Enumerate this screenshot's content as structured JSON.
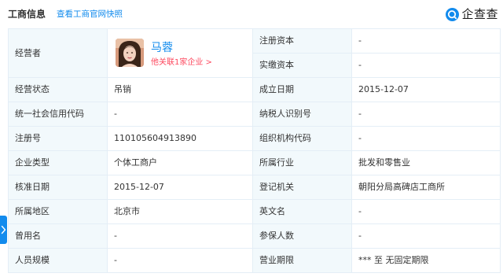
{
  "header": {
    "section_title": "工商信息",
    "snapshot_link": "查看工商官网快照",
    "brand_name": "企查查",
    "brand_icon": "qcc-logo-icon"
  },
  "operator": {
    "label": "经营者",
    "name": "马蓉",
    "associated_link": "他关联1家企业 >",
    "avatar": "operator-avatar"
  },
  "capital": {
    "registered_label": "注册资本",
    "registered_value": "-",
    "paid_label": "实缴资本",
    "paid_value": "-"
  },
  "rows": [
    {
      "k1": "经营状态",
      "v1": "吊销",
      "k2": "成立日期",
      "v2": "2015-12-07"
    },
    {
      "k1": "统一社会信用代码",
      "v1": "-",
      "k2": "纳税人识别号",
      "v2": "-"
    },
    {
      "k1": "注册号",
      "v1": "110105604913890",
      "k2": "组织机构代码",
      "v2": "-"
    },
    {
      "k1": "企业类型",
      "v1": "个体工商户",
      "k2": "所属行业",
      "v2": "批发和零售业"
    },
    {
      "k1": "核准日期",
      "v1": "2015-12-07",
      "k2": "登记机关",
      "v2": "朝阳分局高碑店工商所"
    },
    {
      "k1": "所属地区",
      "v1": "北京市",
      "k2": "英文名",
      "v2": "-"
    },
    {
      "k1": "曾用名",
      "v1": "-",
      "k2": "参保人数",
      "v2": "-"
    },
    {
      "k1": "人员规模",
      "v1": "-",
      "k2": "营业期限",
      "v2": "*** 至 无固定期限"
    }
  ],
  "side_tab_icon": "chevron-right-icon",
  "colors": {
    "accent": "#128bed",
    "link_red": "#fd485e",
    "key_bg": "#f2f9fc",
    "border": "#e4eef6"
  }
}
